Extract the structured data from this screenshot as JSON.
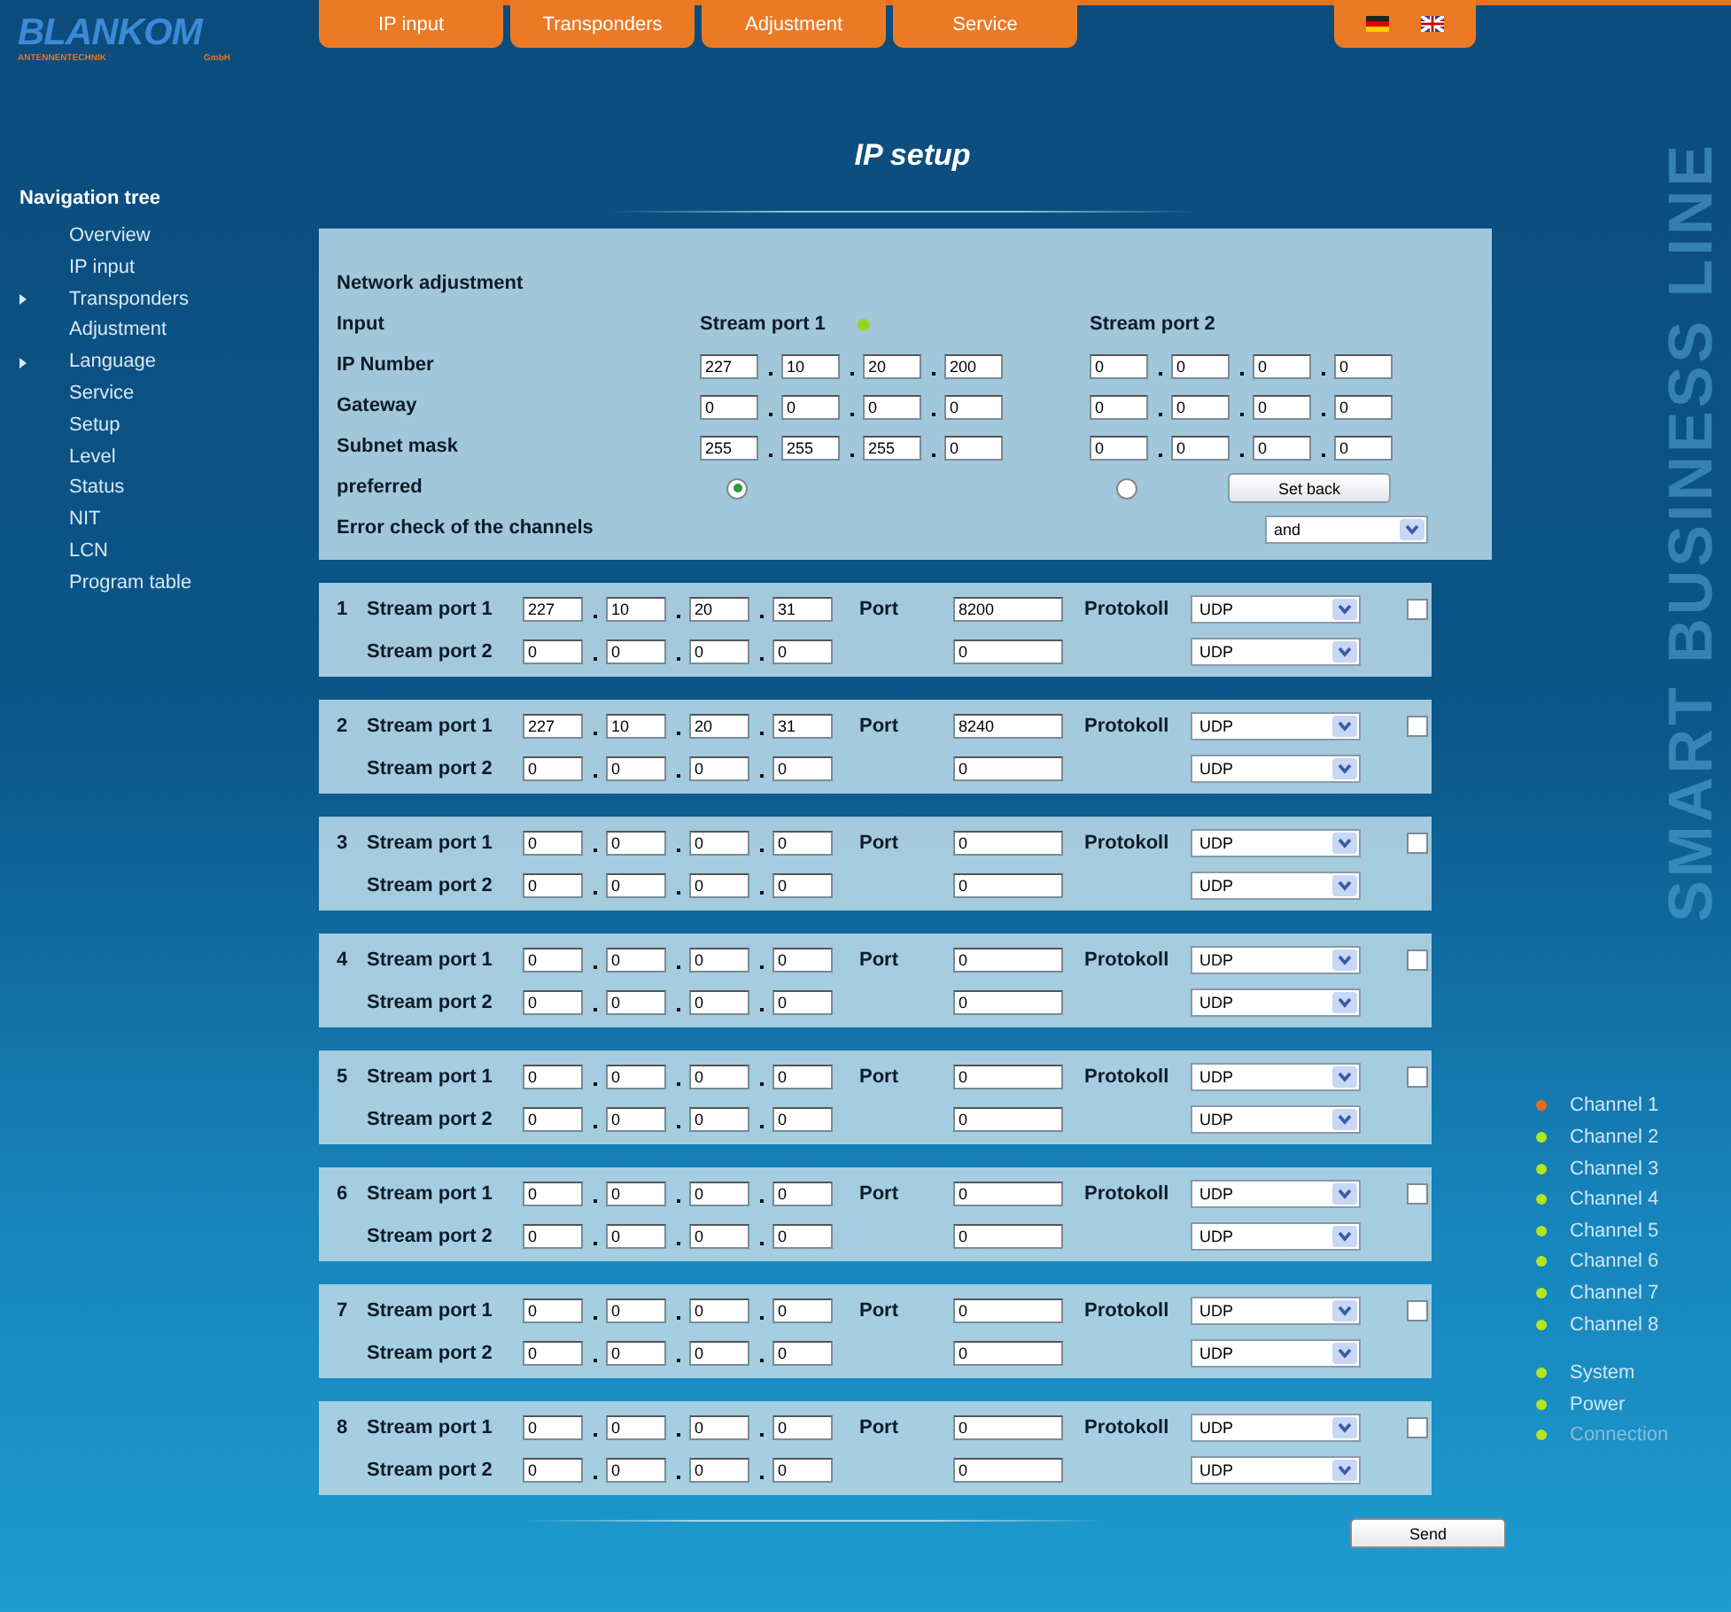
{
  "logo": {
    "name": "BLANKOM",
    "subtitle": "ANTENNENTECHNIK",
    "suffix": "GmbH"
  },
  "tabs": [
    {
      "label": "IP input"
    },
    {
      "label": "Transponders"
    },
    {
      "label": "Adjustment"
    },
    {
      "label": "Service"
    }
  ],
  "navigation": {
    "title": "Navigation tree",
    "items": [
      {
        "label": "Overview",
        "expandable": false
      },
      {
        "label": "IP input",
        "expandable": false
      },
      {
        "label": "Transponders",
        "expandable": true
      },
      {
        "label": "Adjustment",
        "expandable": false
      },
      {
        "label": "Language",
        "expandable": true
      },
      {
        "label": "Service",
        "expandable": false
      },
      {
        "label": "Setup",
        "expandable": false
      },
      {
        "label": "Level",
        "expandable": false
      },
      {
        "label": "Status",
        "expandable": false
      },
      {
        "label": "NIT",
        "expandable": false
      },
      {
        "label": "LCN",
        "expandable": false
      },
      {
        "label": "Program table",
        "expandable": false
      }
    ]
  },
  "page_title": "IP setup",
  "network": {
    "title": "Network adjustment",
    "input_label": "Input",
    "ports": [
      {
        "label": "Stream port 1",
        "color": "#9bd22a"
      },
      {
        "label": "Stream port 2"
      }
    ],
    "rows": [
      {
        "label": "IP Number",
        "values": [
          [
            "227",
            "10",
            "20",
            "200"
          ],
          [
            "0",
            "0",
            "0",
            "0"
          ]
        ]
      },
      {
        "label": "Gateway",
        "values": [
          [
            "0",
            "0",
            "0",
            "0"
          ],
          [
            "0",
            "0",
            "0",
            "0"
          ]
        ]
      },
      {
        "label": "Subnet mask",
        "values": [
          [
            "255",
            "255",
            "255",
            "0"
          ],
          [
            "0",
            "0",
            "0",
            "0"
          ]
        ]
      }
    ],
    "preferred": {
      "label": "preferred",
      "options": [
        {
          "selected": true
        },
        {
          "selected": false
        }
      ]
    },
    "set_back": "Set back",
    "error_check": {
      "label": "Error check of the channels",
      "value": "and"
    }
  },
  "channels": [
    {
      "number": "1",
      "checked": false,
      "streams": [
        {
          "label": "Stream port 1",
          "ip": [
            "227",
            "10",
            "20",
            "31"
          ],
          "port_label": "Port",
          "port": "8200",
          "protocol_label": "Protokoll",
          "protocol": "UDP"
        },
        {
          "label": "Stream port 2",
          "ip": [
            "0",
            "0",
            "0",
            "0"
          ],
          "port": "0",
          "protocol": "UDP"
        }
      ]
    },
    {
      "number": "2",
      "checked": false,
      "streams": [
        {
          "label": "Stream port 1",
          "ip": [
            "227",
            "10",
            "20",
            "31"
          ],
          "port_label": "Port",
          "port": "8240",
          "protocol_label": "Protokoll",
          "protocol": "UDP"
        },
        {
          "label": "Stream port 2",
          "ip": [
            "0",
            "0",
            "0",
            "0"
          ],
          "port": "0",
          "protocol": "UDP"
        }
      ]
    },
    {
      "number": "3",
      "checked": false,
      "streams": [
        {
          "label": "Stream port 1",
          "ip": [
            "0",
            "0",
            "0",
            "0"
          ],
          "port_label": "Port",
          "port": "0",
          "protocol_label": "Protokoll",
          "protocol": "UDP"
        },
        {
          "label": "Stream port 2",
          "ip": [
            "0",
            "0",
            "0",
            "0"
          ],
          "port": "0",
          "protocol": "UDP"
        }
      ]
    },
    {
      "number": "4",
      "checked": false,
      "streams": [
        {
          "label": "Stream port 1",
          "ip": [
            "0",
            "0",
            "0",
            "0"
          ],
          "port_label": "Port",
          "port": "0",
          "protocol_label": "Protokoll",
          "protocol": "UDP"
        },
        {
          "label": "Stream port 2",
          "ip": [
            "0",
            "0",
            "0",
            "0"
          ],
          "port": "0",
          "protocol": "UDP"
        }
      ]
    },
    {
      "number": "5",
      "checked": false,
      "streams": [
        {
          "label": "Stream port 1",
          "ip": [
            "0",
            "0",
            "0",
            "0"
          ],
          "port_label": "Port",
          "port": "0",
          "protocol_label": "Protokoll",
          "protocol": "UDP"
        },
        {
          "label": "Stream port 2",
          "ip": [
            "0",
            "0",
            "0",
            "0"
          ],
          "port": "0",
          "protocol": "UDP"
        }
      ]
    },
    {
      "number": "6",
      "checked": false,
      "streams": [
        {
          "label": "Stream port 1",
          "ip": [
            "0",
            "0",
            "0",
            "0"
          ],
          "port_label": "Port",
          "port": "0",
          "protocol_label": "Protokoll",
          "protocol": "UDP"
        },
        {
          "label": "Stream port 2",
          "ip": [
            "0",
            "0",
            "0",
            "0"
          ],
          "port": "0",
          "protocol": "UDP"
        }
      ]
    },
    {
      "number": "7",
      "checked": false,
      "streams": [
        {
          "label": "Stream port 1",
          "ip": [
            "0",
            "0",
            "0",
            "0"
          ],
          "port_label": "Port",
          "port": "0",
          "protocol_label": "Protokoll",
          "protocol": "UDP"
        },
        {
          "label": "Stream port 2",
          "ip": [
            "0",
            "0",
            "0",
            "0"
          ],
          "port": "0",
          "protocol": "UDP"
        }
      ]
    },
    {
      "number": "8",
      "checked": false,
      "streams": [
        {
          "label": "Stream port 1",
          "ip": [
            "0",
            "0",
            "0",
            "0"
          ],
          "port_label": "Port",
          "port": "0",
          "protocol_label": "Protokoll",
          "protocol": "UDP"
        },
        {
          "label": "Stream port 2",
          "ip": [
            "0",
            "0",
            "0",
            "0"
          ],
          "port": "0",
          "protocol": "UDP"
        }
      ]
    }
  ],
  "send": "Send",
  "slogan": "SMART BUSINESS LINE",
  "status": [
    {
      "label": "Channel 1",
      "color": "#f06a1e",
      "dimmed": false
    },
    {
      "label": "Channel 2",
      "color": "#b5e61d",
      "dimmed": false
    },
    {
      "label": "Channel 3",
      "color": "#b5e61d",
      "dimmed": false
    },
    {
      "label": "Channel 4",
      "color": "#b5e61d",
      "dimmed": false
    },
    {
      "label": "Channel 5",
      "color": "#b5e61d",
      "dimmed": false
    },
    {
      "label": "Channel 6",
      "color": "#b5e61d",
      "dimmed": false
    },
    {
      "label": "Channel 7",
      "color": "#b5e61d",
      "dimmed": false
    },
    {
      "label": "Channel 8",
      "color": "#b5e61d",
      "dimmed": false
    }
  ],
  "system_status": [
    {
      "label": "System",
      "color": "#b5e61d",
      "dimmed": false
    },
    {
      "label": "Power",
      "color": "#b5e61d",
      "dimmed": false
    },
    {
      "label": "Connection",
      "color": "#b5e61d",
      "dimmed": true
    }
  ]
}
